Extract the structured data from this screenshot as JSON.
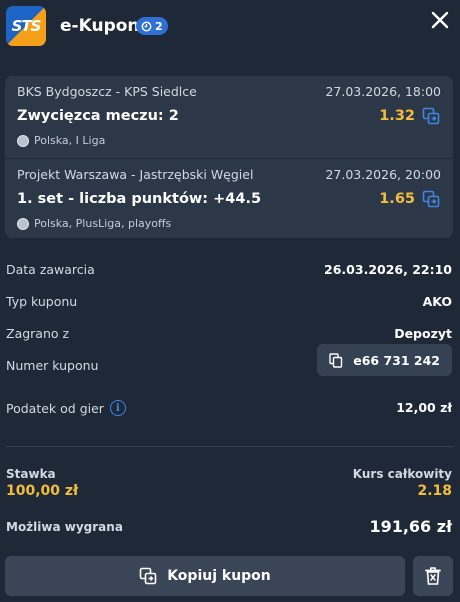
{
  "header": {
    "logo_text": "STS",
    "title": "e-Kupon",
    "badge_count": "2",
    "close_icon": "close-icon"
  },
  "bets": [
    {
      "match": "BKS Bydgoszcz - KPS Siedlce",
      "datetime": "27.03.2026, 18:00",
      "market": "Zwycięzca meczu: 2",
      "odds": "1.32",
      "league": "Polska, I Liga"
    },
    {
      "match": "Projekt Warszawa - Jastrzębski Węgiel",
      "datetime": "27.03.2026, 20:00",
      "market": "1. set - liczba punktów: +44.5",
      "odds": "1.65",
      "league": "Polska, PlusLiga, playoffs"
    }
  ],
  "details": {
    "date_label": "Data zawarcia",
    "date_value": "26.03.2026, 22:10",
    "type_label": "Typ kuponu",
    "type_value": "AKO",
    "played_label": "Zagrano z",
    "played_value": "Depozyt",
    "number_label": "Numer kuponu",
    "number_value": "e66 731 242",
    "tax_label": "Podatek od gier",
    "tax_value": "12,00 zł"
  },
  "summary": {
    "stake_label": "Stawka",
    "stake_value": "100,00 zł",
    "rate_label": "Kurs całkowity",
    "rate_value": "2.18",
    "win_label": "Możliwa wygrana",
    "win_value": "191,66 zł"
  },
  "actions": {
    "copy_label": "Kopiuj kupon"
  },
  "colors": {
    "background": "#1f2836",
    "card": "#2c3747",
    "accent_odds": "#f3bd3c",
    "accent_blue": "#2f6fd6"
  }
}
